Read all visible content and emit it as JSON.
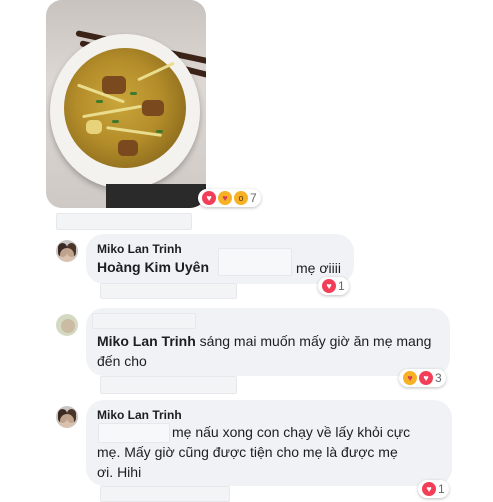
{
  "post_photo": {
    "reaction_count": "7",
    "reactions": [
      "heart-icon",
      "care-icon",
      "wow-icon"
    ]
  },
  "comments": [
    {
      "author": "Miko Lan Trinh",
      "tagged_name": "Hoàng Kim Uyên",
      "text": "mẹ ơiiii",
      "reaction_count": "1"
    },
    {
      "author": "Miko Lan Trinh",
      "text": "sáng mai muốn mấy giờ ăn mẹ mang đến cho",
      "reaction_count": "3"
    },
    {
      "author": "Miko Lan Trinh",
      "text_line1": "mẹ nấu xong con chạy về lấy khỏi cực",
      "text_line2": "mẹ. Mấy giờ cũng được tiện cho mẹ là được mẹ",
      "text_line3": "ơi. Hihi",
      "reaction_count": "1"
    }
  ],
  "colors": {
    "bubble": "#f0f2f5",
    "heart": "#f33e58",
    "text": "#1c1e21",
    "meta": "#65676b"
  }
}
